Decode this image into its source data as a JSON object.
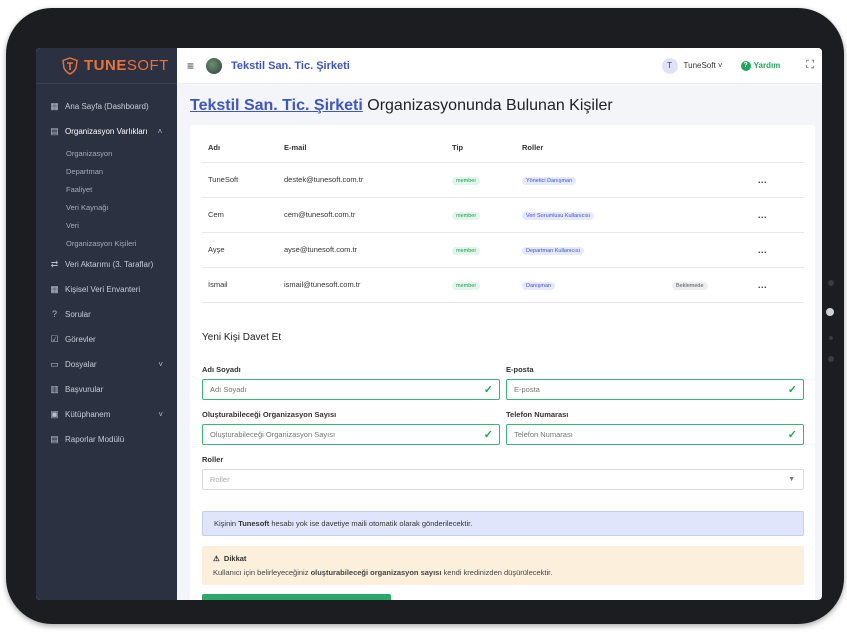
{
  "brand": {
    "logo_bold": "TUNE",
    "logo_light": "SOFT"
  },
  "sidebar": {
    "items": [
      {
        "label": "Ana Sayfa (Dashboard)",
        "icon": "dashboard-icon"
      },
      {
        "label": "Organizasyon Varlıkları",
        "icon": "building-icon",
        "expanded": true,
        "children": [
          "Organizasyon",
          "Departman",
          "Faaliyet",
          "Veri Kaynağı",
          "Veri",
          "Organizasyon Kişileri"
        ]
      },
      {
        "label": "Veri Aktarımı (3. Taraflar)",
        "icon": "transfer-icon"
      },
      {
        "label": "Kişisel Veri Envanteri",
        "icon": "table-icon"
      },
      {
        "label": "Sorular",
        "icon": "question-icon"
      },
      {
        "label": "Görevler",
        "icon": "tasks-icon"
      },
      {
        "label": "Dosyalar",
        "icon": "folder-icon",
        "has_children": true
      },
      {
        "label": "Başvurular",
        "icon": "applications-icon"
      },
      {
        "label": "Kütüphanem",
        "icon": "library-icon",
        "has_children": true
      },
      {
        "label": "Raporlar Modülü",
        "icon": "reports-icon"
      }
    ]
  },
  "topbar": {
    "org_name": "Tekstil San. Tic. Şirketi",
    "user_initial": "T",
    "user_name": "TuneSoft",
    "help_label": "Yardım"
  },
  "page": {
    "title_link": "Tekstil San. Tic. Şirketi",
    "title_rest": " Organizasyonunda Bulunan Kişiler"
  },
  "table": {
    "headers": [
      "Adı",
      "E-mail",
      "Tip",
      "Roller",
      "",
      ""
    ],
    "rows": [
      {
        "name": "TuneSoft",
        "email": "destek@tunesoft.com.tr",
        "type": "member",
        "role": "Yönetici Danışman",
        "status": "",
        "actions": "..."
      },
      {
        "name": "Cem",
        "email": "cem@tunesoft.com.tr",
        "type": "member",
        "role": "Veri Sorumlusu Kullanıcısı",
        "status": "",
        "actions": "..."
      },
      {
        "name": "Ayşe",
        "email": "ayse@tunesoft.com.tr",
        "type": "member",
        "role": "Departman Kullanıcısı",
        "status": "",
        "actions": "..."
      },
      {
        "name": "İsmail",
        "email": "ismail@tunesoft.com.tr",
        "type": "member",
        "role": "Danışman",
        "status": "Beklemede",
        "actions": "..."
      }
    ]
  },
  "invite": {
    "section_title": "Yeni Kişi Davet Et",
    "name_label": "Adı Soyadı",
    "name_placeholder": "Adı Soyadı",
    "email_label": "E-posta",
    "email_placeholder": "E-posta",
    "org_count_label": "Oluşturabileceği Organizasyon Sayısı",
    "org_count_placeholder": "Oluşturabileceği Organizasyon Sayısı",
    "phone_label": "Telefon Numarası",
    "phone_placeholder": "Telefon Numarası",
    "roles_label": "Roller",
    "roles_placeholder": "Roller"
  },
  "info": {
    "prefix": "Kişinin ",
    "bold": "Tunesoft",
    "suffix": " hesabı yok ise davetiye maili otomatik olarak gönderilecektir."
  },
  "warning": {
    "title": "Dikkat",
    "prefix": "Kullanıcı için belirleyeceğiniz ",
    "bold": "oluşturabileceği organizasyon sayısı",
    "suffix": " kendi kredinizden düşürülecektir."
  },
  "colors": {
    "primary": "#3d55c8",
    "success": "#22a65a",
    "sidebar": "#2c3142",
    "brand_orange": "#e8743a"
  }
}
